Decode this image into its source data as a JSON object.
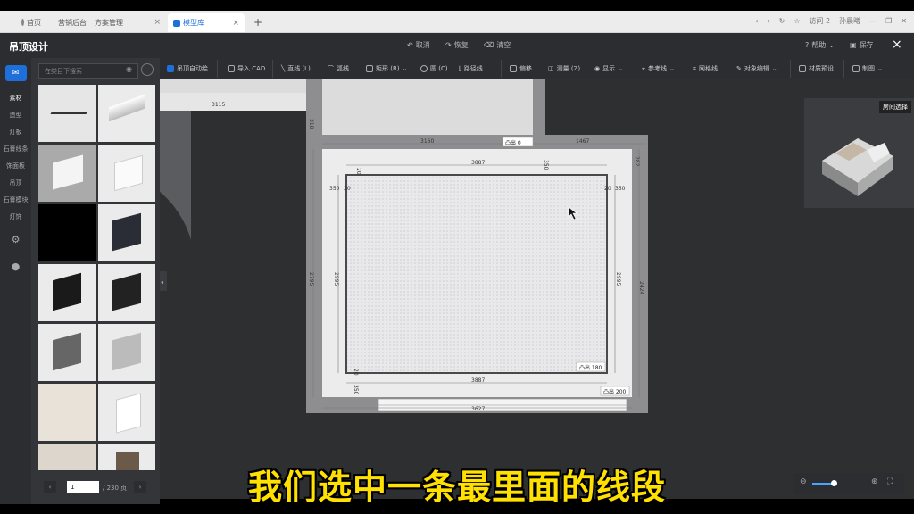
{
  "browser": {
    "tabs": [
      {
        "label": "首页"
      },
      {
        "label": "营销后台"
      },
      {
        "label": "方案管理"
      },
      {
        "label": "模型库",
        "active": true
      }
    ],
    "new_tab": "+",
    "user": "访问 2",
    "user_name": "孙晨曦"
  },
  "app": {
    "title": "吊顶设计",
    "undo": "取消",
    "redo": "恢复",
    "clear": "清空",
    "help": "帮助",
    "save": "保存",
    "close": "×"
  },
  "toolbar": {
    "items": [
      {
        "label": "吊顶自动绘"
      },
      {
        "label": "导入 CAD"
      },
      {
        "label": "直线 (L)"
      },
      {
        "label": "弧线"
      },
      {
        "label": "矩形 (R)"
      },
      {
        "label": "圆 (C)"
      },
      {
        "label": "路径线"
      },
      {
        "label": "偏移"
      },
      {
        "label": "测量 (Z)"
      },
      {
        "label": "显示"
      },
      {
        "label": "参考线"
      },
      {
        "label": "网格线"
      },
      {
        "label": "对象编辑"
      },
      {
        "label": "材质预设"
      },
      {
        "label": "制图"
      }
    ]
  },
  "rail": {
    "items": [
      {
        "label": "素材"
      },
      {
        "label": "造型"
      },
      {
        "label": "灯板"
      },
      {
        "label": "石膏线条"
      },
      {
        "label": "饰面板"
      },
      {
        "label": "吊顶"
      },
      {
        "label": "石膏模块"
      },
      {
        "label": "灯饰"
      }
    ]
  },
  "materials": {
    "search_placeholder": "在类目下搜索",
    "page": "1",
    "total_pages": "/ 230 页"
  },
  "plan": {
    "dims": {
      "top_left": "3115",
      "wall_top": "3160",
      "wall_top_right": "1467",
      "inner_top": "3887",
      "left_outer": "2795",
      "left_inner": "2995",
      "right_inner": "2995",
      "right_outer": "2424",
      "bottom_inner": "3887",
      "bottom_outer": "3627",
      "v350_tl": "350",
      "v20_tl": "20",
      "v20_tr": "20",
      "v350_tr": "350",
      "v350_top": "350",
      "v20_top": "20",
      "v350_bottom": "350",
      "v20_bottom": "20",
      "small_left": "318",
      "small_right": "282"
    },
    "protrude_top": "凸出 0",
    "protrude_inner": "凸出 180",
    "protrude_bottom": "凸出 200"
  },
  "minimap": {
    "label": "房间选择"
  },
  "caption": "我们选中一条最里面的线段"
}
